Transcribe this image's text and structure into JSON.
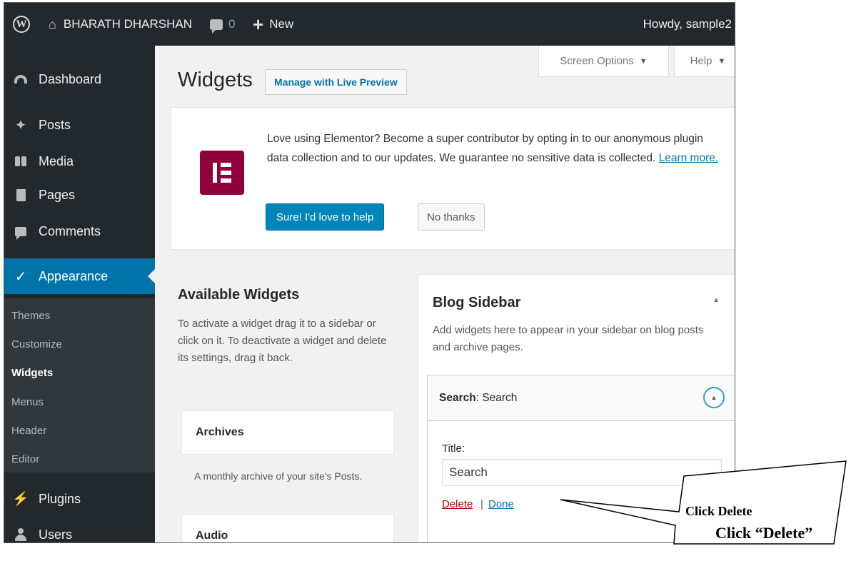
{
  "admin_bar": {
    "site_name": "BHARATH DHARSHAN",
    "comment_count": "0",
    "new_label": "New",
    "howdy": "Howdy, sample2"
  },
  "menu": {
    "items": [
      {
        "label": "Dashboard",
        "icon": "dashboard-icon"
      },
      {
        "label": "Posts",
        "icon": "pin-icon"
      },
      {
        "label": "Media",
        "icon": "media-icon"
      },
      {
        "label": "Pages",
        "icon": "pages-icon"
      },
      {
        "label": "Comments",
        "icon": "comments-icon"
      },
      {
        "label": "Appearance",
        "icon": "paintbrush-icon"
      },
      {
        "label": "Plugins",
        "icon": "plugin-icon"
      },
      {
        "label": "Users",
        "icon": "users-icon"
      }
    ],
    "submenu": [
      "Themes",
      "Customize",
      "Widgets",
      "Menus",
      "Header",
      "Editor"
    ],
    "current_submenu": "Widgets"
  },
  "header": {
    "title": "Widgets",
    "live_preview": "Manage with Live Preview",
    "screen_options": "Screen Options",
    "help": "Help"
  },
  "notice": {
    "text": "Love using Elementor? Become a super contributor by opting in to our anonymous plugin data collection and to our updates. We guarantee no sensitive data is collected.",
    "learn_more": "Learn more.",
    "primary_button": "Sure! I'd love to help",
    "secondary_button": "No thanks"
  },
  "available": {
    "title": "Available Widgets",
    "description": "To activate a widget drag it to a sidebar or click on it. To deactivate a widget and delete its settings, drag it back.",
    "widgets": [
      {
        "name": "Archives",
        "desc": "A monthly archive of your site's Posts."
      },
      {
        "name": "Audio",
        "desc": ""
      }
    ]
  },
  "blog_sidebar": {
    "title": "Blog Sidebar",
    "description": "Add widgets here to appear in your sidebar on blog posts and archive pages.",
    "widget_head_bold": "Search",
    "widget_head_rest": ": Search",
    "title_label": "Title:",
    "title_value": "Search",
    "delete": "Delete",
    "separator": "|",
    "done": "Done"
  },
  "callout": {
    "line1": "Click Delete",
    "line2": "Click “Delete”"
  },
  "colors": {
    "admin_bar": "#23282d",
    "accent": "#0073aa",
    "primary_button": "#0085ba",
    "elementor": "#92003b",
    "delete": "#aa0000"
  }
}
